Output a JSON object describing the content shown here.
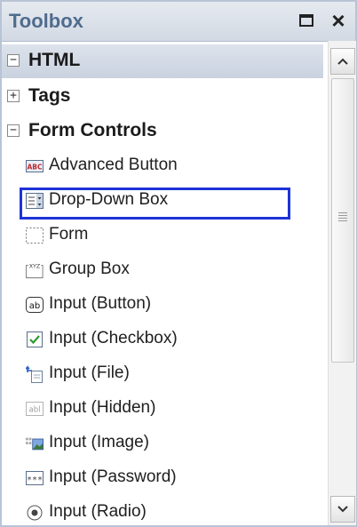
{
  "window": {
    "title": "Toolbox"
  },
  "section": {
    "label": "HTML",
    "expander": "−"
  },
  "categories": [
    {
      "label": "Tags",
      "expander": "+"
    },
    {
      "label": "Form Controls",
      "expander": "−"
    }
  ],
  "items": [
    {
      "label": "Advanced Button",
      "icon": "advanced-button-icon"
    },
    {
      "label": "Drop-Down Box",
      "icon": "dropdown-box-icon"
    },
    {
      "label": "Form",
      "icon": "form-icon"
    },
    {
      "label": "Group Box",
      "icon": "group-box-icon"
    },
    {
      "label": "Input (Button)",
      "icon": "input-button-icon"
    },
    {
      "label": "Input (Checkbox)",
      "icon": "input-checkbox-icon"
    },
    {
      "label": "Input (File)",
      "icon": "input-file-icon"
    },
    {
      "label": "Input (Hidden)",
      "icon": "input-hidden-icon"
    },
    {
      "label": "Input (Image)",
      "icon": "input-image-icon"
    },
    {
      "label": "Input (Password)",
      "icon": "input-password-icon"
    },
    {
      "label": "Input (Radio)",
      "icon": "input-radio-icon"
    }
  ],
  "icon_text": {
    "advanced_button": "ABC",
    "group_box": "XYZ",
    "input_button": "ab",
    "input_hidden": "abl",
    "input_password": "***"
  },
  "colors": {
    "accent_selection": "#1e33d8",
    "title_text": "#4f6c8e",
    "checkbox_check": "#2f9a2f"
  }
}
